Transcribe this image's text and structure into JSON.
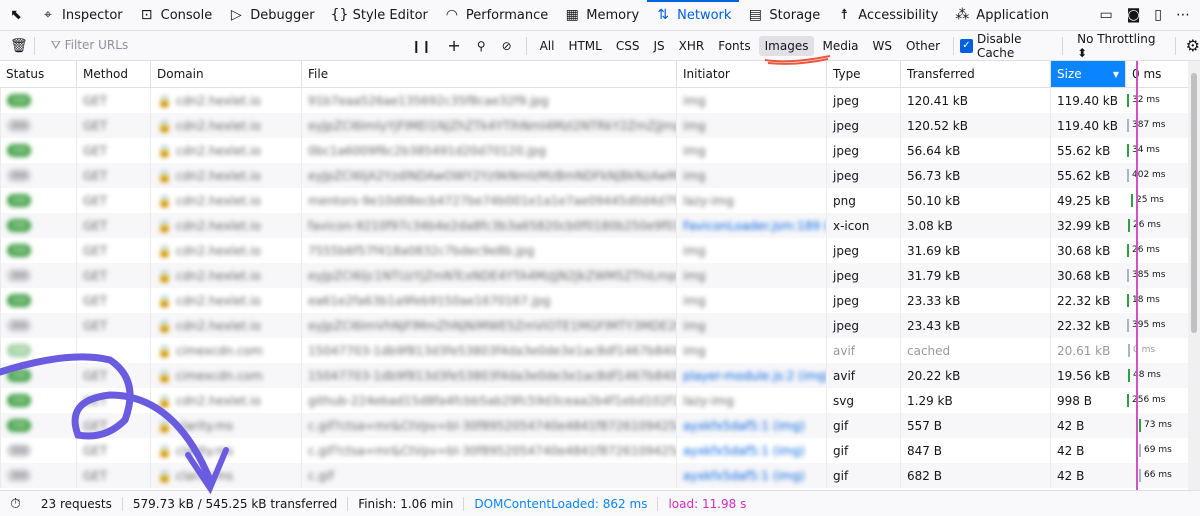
{
  "tabs": [
    {
      "label": "Inspector",
      "icon": "inspector-icon"
    },
    {
      "label": "Console",
      "icon": "console-icon"
    },
    {
      "label": "Debugger",
      "icon": "debugger-icon"
    },
    {
      "label": "Style Editor",
      "icon": "braces-icon"
    },
    {
      "label": "Performance",
      "icon": "gauge-icon"
    },
    {
      "label": "Memory",
      "icon": "memory-icon"
    },
    {
      "label": "Network",
      "icon": "network-arrows-icon",
      "active": true
    },
    {
      "label": "Storage",
      "icon": "storage-icon"
    },
    {
      "label": "Accessibility",
      "icon": "accessibility-icon"
    },
    {
      "label": "Application",
      "icon": "grid-icon"
    }
  ],
  "toolbar": {
    "filter_placeholder": "Filter URLs",
    "filters": [
      "All",
      "HTML",
      "CSS",
      "JS",
      "XHR",
      "Fonts",
      "Images",
      "Media",
      "WS",
      "Other"
    ],
    "selected_filter": "Images",
    "disable_cache": "Disable Cache",
    "throttling": "No Throttling"
  },
  "columns": [
    "Status",
    "Method",
    "Domain",
    "File",
    "Initiator",
    "Type",
    "Transferred",
    "Size",
    "0 ms"
  ],
  "rows": [
    {
      "status": "200",
      "method": "GET",
      "domain": "cdn2.hexlet.io",
      "file": "91b7eaa526ae135692c35f8cae32f9.jpg",
      "initiator": "img",
      "type": "jpeg",
      "transferred": "120.41 kB",
      "size": "119.40 kB",
      "time": "32 ms",
      "ok": true
    },
    {
      "status": "304",
      "method": "GET",
      "domain": "cdn2.hexlet.io",
      "file": "eyJpZCI6ImlyYjFIMEI1NjZhZTk4YTlhNmI4MzI2NTRkY2ZmZjJmpeZjc",
      "initiator": "img",
      "type": "jpeg",
      "transferred": "120.52 kB",
      "size": "119.40 kB",
      "time": "387 ms",
      "ok": false
    },
    {
      "status": "200",
      "method": "GET",
      "domain": "cdn2.hexlet.io",
      "file": "0bc1a6009f6c2b385491d20d70120.jpg",
      "initiator": "img",
      "type": "jpeg",
      "transferred": "56.64 kB",
      "size": "55.62 kB",
      "time": "34 ms",
      "ok": true
    },
    {
      "status": "304",
      "method": "GET",
      "domain": "cdn2.hexlet.io",
      "file": "eyJpZCI6ljA2YzdlNDAwOWY2Yz9kNmIzMzBmNDFkNjBkNzAwMTacnpc",
      "initiator": "img",
      "type": "jpeg",
      "transferred": "56.73 kB",
      "size": "55.62 kB",
      "time": "402 ms",
      "ok": false
    },
    {
      "status": "200",
      "method": "GET",
      "domain": "cdn2.hexlet.io",
      "file": "mentors-9e10d08ecb4727be74b001e1a1e7ae09445d0d4d7fc2c2",
      "initiator": "lazy-img",
      "type": "png",
      "transferred": "50.10 kB",
      "size": "49.25 kB",
      "time": "25 ms",
      "ok": true
    },
    {
      "status": "200",
      "method": "GET",
      "domain": "cdn2.hexlet.io",
      "file": "favicon-9210f97c34b4e2da8fc3b3a65820cb0f0180b250e9f014f1d",
      "initiator": "FaviconLoader.jsm:189 (img)",
      "type": "x-icon",
      "transferred": "3.08 kB",
      "size": "32.99 kB",
      "time": "26 ms",
      "ok": true,
      "link": true
    },
    {
      "status": "200",
      "method": "GET",
      "domain": "cdn2.hexlet.io",
      "file": "7555b6f57f418a0832c7bdec9e8b.jpg",
      "initiator": "img",
      "type": "jpeg",
      "transferred": "31.69 kB",
      "size": "30.68 kB",
      "time": "26 ms",
      "ok": true
    },
    {
      "status": "304",
      "method": "GET",
      "domain": "cdn2.hexlet.io",
      "file": "eyJpZCI6ljc1NTUzYjZmNTcxNDE4YTA4MzJjN2JkZWM5ZThiLmpwZyIs",
      "initiator": "img",
      "type": "jpeg",
      "transferred": "31.79 kB",
      "size": "30.68 kB",
      "time": "385 ms",
      "ok": false
    },
    {
      "status": "200",
      "method": "GET",
      "domain": "cdn2.hexlet.io",
      "file": "ea61e2fa63b1a9feb9150ae1670167.jpg",
      "initiator": "img",
      "type": "jpeg",
      "transferred": "23.33 kB",
      "size": "22.32 kB",
      "time": "18 ms",
      "ok": true
    },
    {
      "status": "304",
      "method": "GET",
      "domain": "cdn2.hexlet.io",
      "file": "eyJpZCI6ImVhNjFlMmZhNjNiMWE5ZmViOTE1MGFlMTY3MDE2Ny5qcGci",
      "initiator": "img",
      "type": "jpeg",
      "transferred": "23.43 kB",
      "size": "22.32 kB",
      "time": "395 ms",
      "ok": false
    },
    {
      "status": "200",
      "method": "",
      "domain": "cimexcdn.com",
      "file": "15047703-1db9f813d3fe53803f4da3e0de3e1ac8df1467b8408",
      "initiator": "img",
      "type": "avif",
      "transferred": "cached",
      "size": "20.61 kB",
      "time": "0 ms",
      "ok": true,
      "cached": true
    },
    {
      "status": "200",
      "method": "GET",
      "domain": "cimexcdn.com",
      "file": "15047703-1db9f813d3fe53803f4da3e0de3e1ac8df1467b8408",
      "initiator": "player-module.js:2 (img)",
      "type": "avif",
      "transferred": "20.22 kB",
      "size": "19.56 kB",
      "time": "48 ms",
      "ok": true,
      "link": true
    },
    {
      "status": "200",
      "method": "GET",
      "domain": "cdn2.hexlet.io",
      "file": "github-224ebad15d8fa4fcbb5ab29fc59d3ceaa2b4f1ebd102f12de14",
      "initiator": "lazy-img",
      "type": "svg",
      "transferred": "1.29 kB",
      "size": "998 B",
      "time": "256 ms",
      "ok": true
    },
    {
      "status": "200",
      "method": "GET",
      "domain": "clarity.ms",
      "file": "c.gif?ctsa=mr&CtVpv=bl-30f8952054740e4841f8726109425c84",
      "initiator": "ayxkfx5daf5:1 (img)",
      "type": "gif",
      "transferred": "557 B",
      "size": "42 B",
      "time": "73 ms",
      "ok": true,
      "link": true
    },
    {
      "status": "304",
      "method": "GET",
      "domain": "clarity.ms",
      "file": "c.gif?ctsa=mr&CtVpv=bl-30f8952054740e4841f8726109425c3b4d",
      "initiator": "ayxkfx5daf5:1 (img)",
      "type": "gif",
      "transferred": "847 B",
      "size": "42 B",
      "time": "69 ms",
      "ok": false,
      "link": true
    },
    {
      "status": "304",
      "method": "GET",
      "domain": "clarity.ms",
      "file": "c.gif",
      "initiator": "ayxkfx5daf5:1 (img)",
      "type": "gif",
      "transferred": "682 B",
      "size": "42 B",
      "time": "66 ms",
      "ok": false,
      "link": true
    }
  ],
  "footer": {
    "requests": "23 requests",
    "transferred": "579.73 kB / 545.25 kB transferred",
    "finish": "Finish: 1.06 min",
    "dcl": "DOMContentLoaded: 862 ms",
    "load": "load: 11.98 s"
  },
  "colors": {
    "accent": "#0061e0",
    "dcl": "#0a84ff",
    "load": "#d52ac6",
    "annotation_arrow": "#6a5ce0",
    "annotation_underline": "#e8583e"
  }
}
